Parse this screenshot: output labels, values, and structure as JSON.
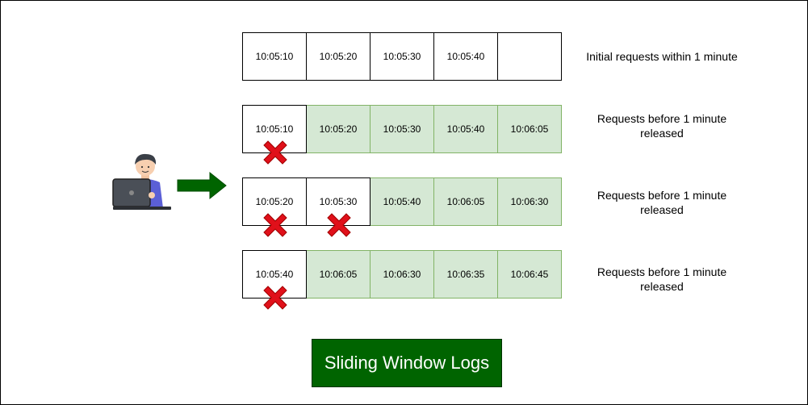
{
  "rows": [
    {
      "cells": [
        {
          "text": "10:05:10",
          "status": "plain"
        },
        {
          "text": "10:05:20",
          "status": "plain"
        },
        {
          "text": "10:05:30",
          "status": "plain"
        },
        {
          "text": "10:05:40",
          "status": "plain"
        },
        {
          "text": "",
          "status": "plain"
        }
      ],
      "label": "Initial requests within 1 minute"
    },
    {
      "cells": [
        {
          "text": "10:05:10",
          "status": "dropped"
        },
        {
          "text": "10:05:20",
          "status": "kept"
        },
        {
          "text": "10:05:30",
          "status": "kept"
        },
        {
          "text": "10:05:40",
          "status": "kept"
        },
        {
          "text": "10:06:05",
          "status": "kept"
        }
      ],
      "label": "Requests before 1 minute released"
    },
    {
      "cells": [
        {
          "text": "10:05:20",
          "status": "dropped"
        },
        {
          "text": "10:05:30",
          "status": "dropped"
        },
        {
          "text": "10:05:40",
          "status": "kept"
        },
        {
          "text": "10:06:05",
          "status": "kept"
        },
        {
          "text": "10:06:30",
          "status": "kept"
        }
      ],
      "label": "Requests before 1 minute released"
    },
    {
      "cells": [
        {
          "text": "10:05:40",
          "status": "dropped"
        },
        {
          "text": "10:06:05",
          "status": "kept"
        },
        {
          "text": "10:06:30",
          "status": "kept"
        },
        {
          "text": "10:06:35",
          "status": "kept"
        },
        {
          "text": "10:06:45",
          "status": "kept"
        }
      ],
      "label": "Requests before 1 minute released"
    }
  ],
  "title": "Sliding Window Logs",
  "colors": {
    "kept_fill": "#d5e8d4",
    "kept_border": "#82b366",
    "title_fill": "#006400",
    "arrow": "#006400",
    "cross": "#e0101a"
  },
  "icons": {
    "user": "user-with-laptop-icon",
    "arrow": "right-arrow-icon",
    "cross": "red-x-icon"
  }
}
